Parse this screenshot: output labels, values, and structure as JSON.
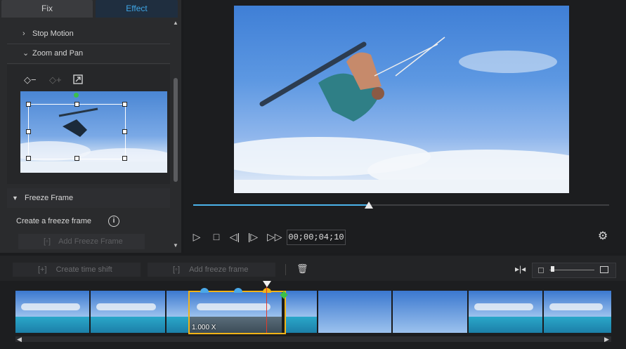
{
  "tabs": {
    "fix": "Fix",
    "effect": "Effect"
  },
  "effects": {
    "stop_motion": "Stop Motion",
    "zoom_and_pan": "Zoom and Pan",
    "freeze_frame": "Freeze Frame",
    "create_freeze_frame": "Create a freeze frame",
    "add_freeze_frame_button": "Add Freeze Frame"
  },
  "player": {
    "timecode": "00;00;04;10",
    "progress": 0.42
  },
  "timeline_toolbar": {
    "create_time_shift": "Create time shift",
    "add_freeze_frame": "Add freeze frame"
  },
  "timeline": {
    "speed_label": "1.000 X"
  },
  "colors": {
    "accent": "#3fa6e6",
    "selection": "#f1b317",
    "playhead": "#e03b2b"
  }
}
